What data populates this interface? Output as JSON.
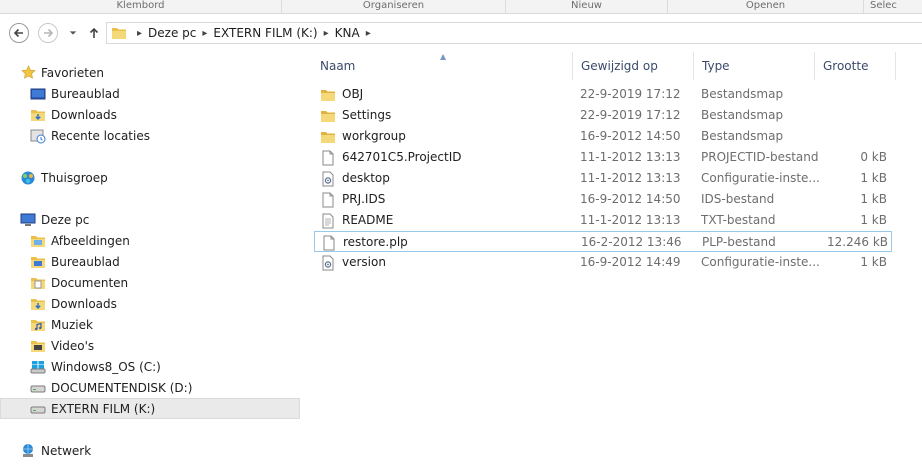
{
  "ribbon": {
    "groups": [
      "Klembord",
      "Organiseren",
      "Nieuw",
      "Openen",
      "Selec"
    ]
  },
  "address": {
    "crumbs": [
      "Deze pc",
      "EXTERN FILM  (K:)",
      "KNA"
    ]
  },
  "navpane": {
    "favorites_label": "Favorieten",
    "favorites": [
      "Bureaublad",
      "Downloads",
      "Recente locaties"
    ],
    "homegroup_label": "Thuisgroep",
    "thispc_label": "Deze pc",
    "thispc": [
      "Afbeeldingen",
      "Bureaublad",
      "Documenten",
      "Downloads",
      "Muziek",
      "Video's",
      "Windows8_OS (C:)",
      "DOCUMENTENDISK (D:)",
      "EXTERN FILM  (K:)"
    ],
    "network_label": "Netwerk"
  },
  "columns": {
    "name": "Naam",
    "modified": "Gewijzigd op",
    "type": "Type",
    "size": "Grootte"
  },
  "files": [
    {
      "name": "OBJ",
      "modified": "22-9-2019 17:12",
      "type": "Bestandsmap",
      "size": "",
      "icon": "folder-icon"
    },
    {
      "name": "Settings",
      "modified": "22-9-2019 17:12",
      "type": "Bestandsmap",
      "size": "",
      "icon": "folder-icon"
    },
    {
      "name": "workgroup",
      "modified": "16-9-2012 14:50",
      "type": "Bestandsmap",
      "size": "",
      "icon": "folder-icon"
    },
    {
      "name": "642701C5.ProjectID",
      "modified": "11-1-2012 13:13",
      "type": "PROJECTID-bestand",
      "size": "0 kB",
      "icon": "file-icon"
    },
    {
      "name": "desktop",
      "modified": "11-1-2012 13:13",
      "type": "Configuratie-inste...",
      "size": "1 kB",
      "icon": "config-file-icon"
    },
    {
      "name": "PRJ.IDS",
      "modified": "16-9-2012 14:50",
      "type": "IDS-bestand",
      "size": "1 kB",
      "icon": "file-icon"
    },
    {
      "name": "README",
      "modified": "11-1-2012 13:13",
      "type": "TXT-bestand",
      "size": "1 kB",
      "icon": "text-file-icon"
    },
    {
      "name": "restore.plp",
      "modified": "16-2-2012 13:46",
      "type": "PLP-bestand",
      "size": "12.246 kB",
      "icon": "file-icon"
    },
    {
      "name": "version",
      "modified": "16-9-2012 14:49",
      "type": "Configuratie-inste...",
      "size": "1 kB",
      "icon": "config-file-icon"
    }
  ],
  "colors": {
    "selection_border": "#99c9e8",
    "header_text": "#3b4a6b",
    "folder_yellow": "#e8c04a"
  }
}
